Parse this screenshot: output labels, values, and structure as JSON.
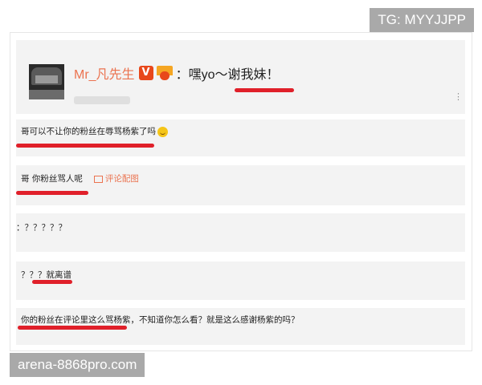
{
  "watermarks": {
    "top_right": "TG: MYYJJPP",
    "bottom_left": "arena-8868pro.com"
  },
  "post": {
    "username": "Mr_凡先生",
    "verified_badge": "V",
    "text": "：嘿yo～谢我妹！",
    "more_icon": "⋮",
    "icons": [
      "avatar-photo",
      "verified-v-icon",
      "crown-icon"
    ]
  },
  "comments": [
    {
      "text": "哥可以不让你的粉丝在辱骂杨紫了吗",
      "has_smile": true
    },
    {
      "text": "哥 你粉丝骂人呢",
      "link": "评论配图"
    },
    {
      "text": "：？？？？？"
    },
    {
      "text": "？？？就离谱"
    },
    {
      "text": "你的粉丝在评论里这么骂杨紫，不知道你怎么看？就是这么感谢杨紫的吗？"
    }
  ],
  "colors": {
    "username": "#eb7350",
    "underline": "#e0202a",
    "card_bg": "#f3f3f3"
  }
}
